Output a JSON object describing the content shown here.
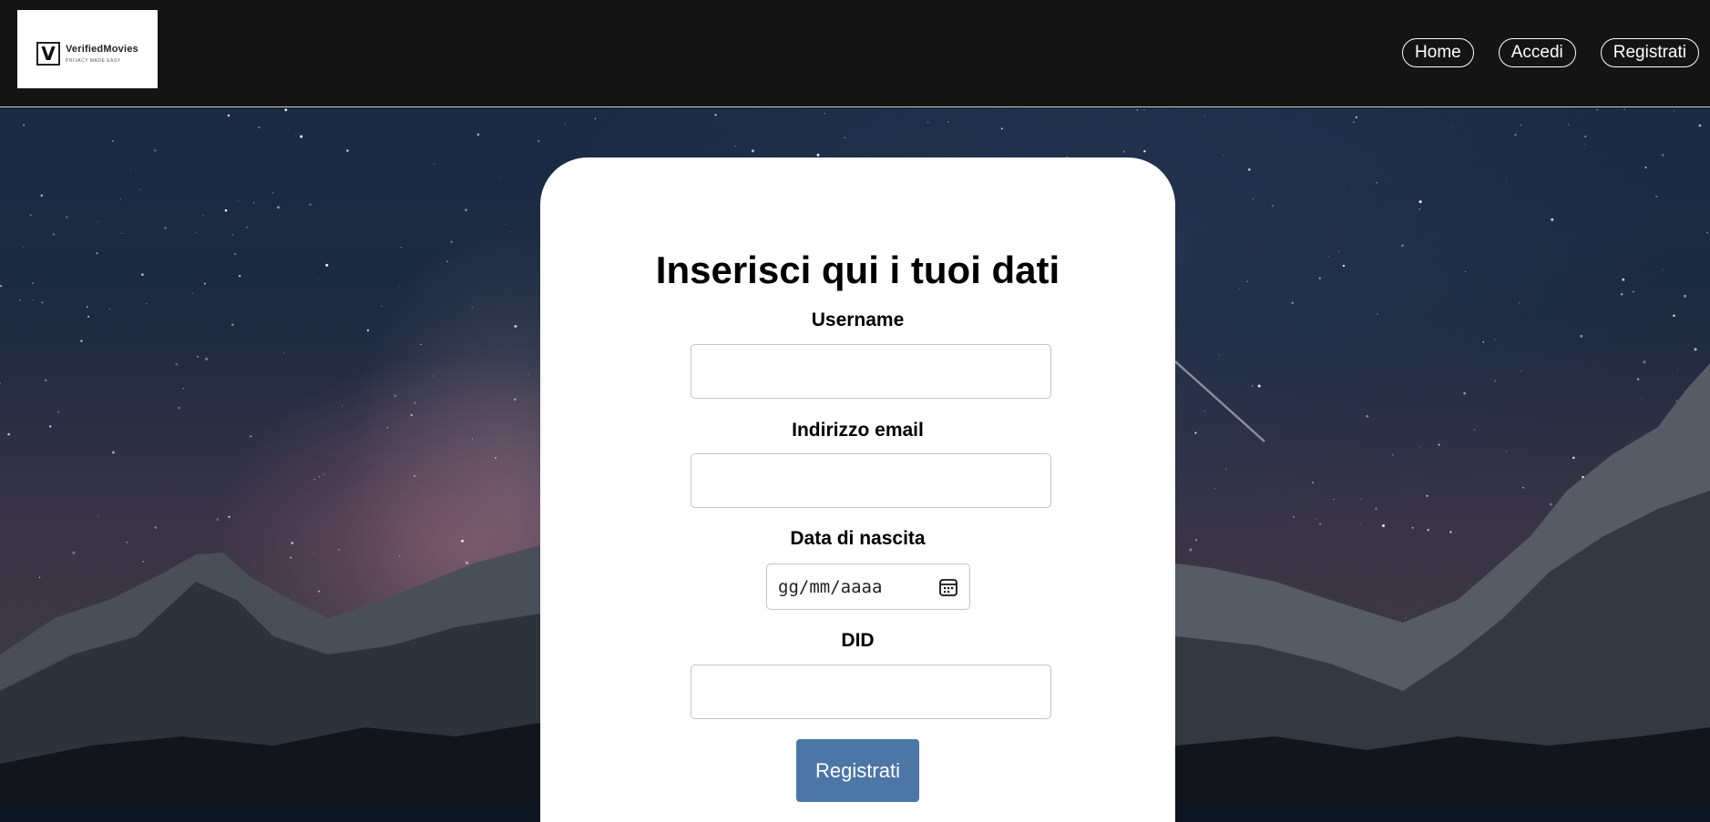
{
  "brand": {
    "name": "VerifiedMovies",
    "tagline": "PRIVACY MADE EASY",
    "logo_letter": "V"
  },
  "nav": {
    "home": "Home",
    "login": "Accedi",
    "register": "Registrati"
  },
  "form": {
    "title": "Inserisci qui i tuoi dati",
    "username_label": "Username",
    "username_value": "",
    "email_label": "Indirizzo email",
    "email_value": "",
    "birthdate_label": "Data di nascita",
    "birthdate_placeholder": "gg/mm/aaaa",
    "did_label": "DID",
    "did_value": "",
    "submit_label": "Registrati"
  },
  "icons": {
    "calendar": "calendar-icon"
  },
  "colors": {
    "navbar": "#141414",
    "submit_button": "#4b76a6",
    "card": "#ffffff"
  }
}
